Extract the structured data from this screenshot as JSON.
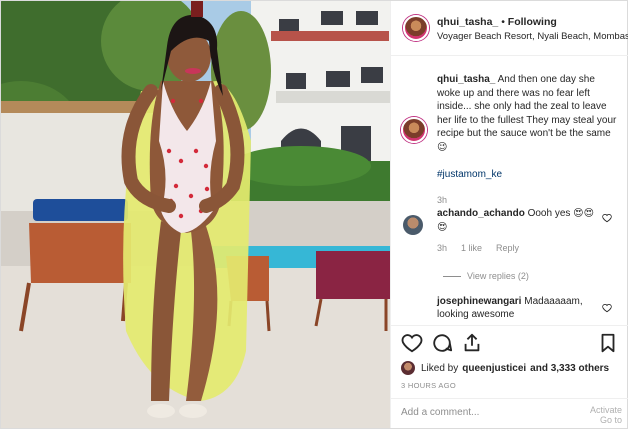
{
  "header": {
    "username": "qhui_tasha_",
    "separator": " • ",
    "follow_status": "Following",
    "location": "Voyager Beach Resort, Nyali Beach, Mombasa"
  },
  "caption": {
    "username": "qhui_tasha_",
    "text": " And then one day she woke up and there was no fear left inside... she only had the zeal to leave her life to the fullest They may steal your recipe but the sauce won't be the same😉",
    "hashtag": "#justamom_ke",
    "time": "3h"
  },
  "comments": [
    {
      "username": "achando_achando",
      "text": " Oooh yes 😍😍😍",
      "time": "3h",
      "likes": "1 like",
      "reply_label": "Reply",
      "view_replies": "View replies (2)"
    },
    {
      "username": "josephinewangari",
      "text": " Madaaaaam, looking awesome"
    }
  ],
  "likes": {
    "prefix": "Liked by ",
    "user": "queenjusticei",
    "suffix": " and 3,333 others"
  },
  "timestamp": "3 HOURS AGO",
  "add_comment_placeholder": "Add a comment...",
  "watermark": {
    "line1": "Activate",
    "line2": "Go to"
  },
  "colors": {
    "accent": "#003569",
    "muted": "#8e8e8e",
    "border": "#dbdbdb"
  }
}
